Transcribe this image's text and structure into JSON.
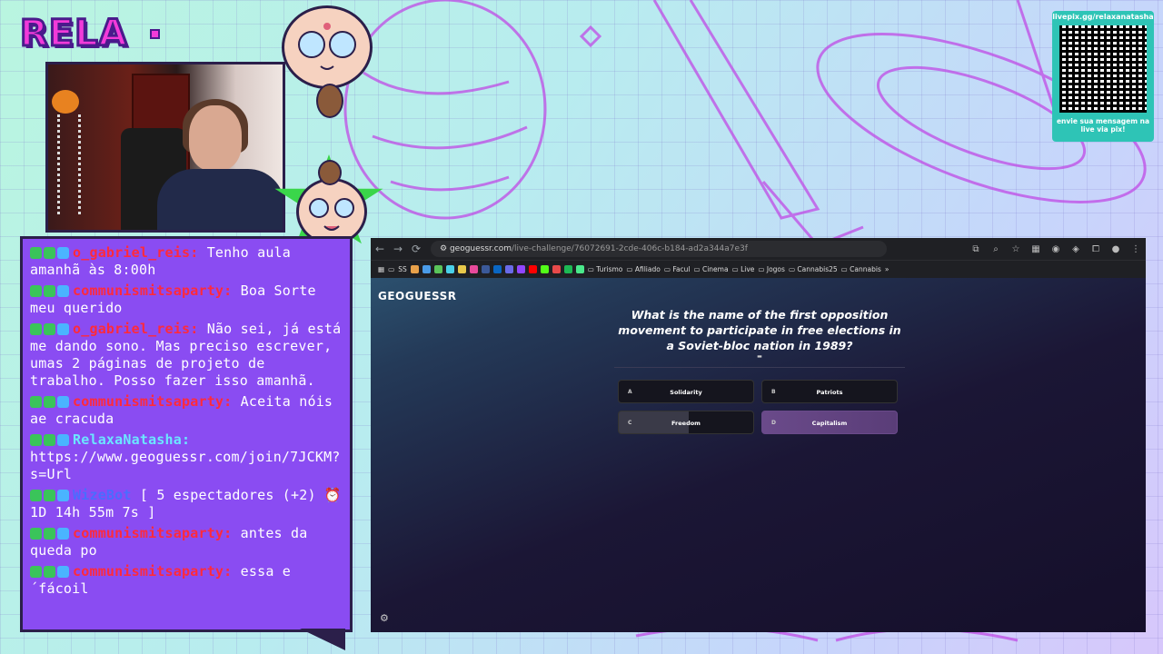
{
  "overlay": {
    "logo_text": "RELA",
    "qr_url": "livepix.gg/relaxanatasha",
    "qr_caption": "envie sua mensagem na live via pix!"
  },
  "chat": {
    "messages": [
      {
        "user": "o_gabriel_reis:",
        "user_color": "red",
        "text": "Tenho aula amanhã às 8:00h"
      },
      {
        "user": "communismitsaparty:",
        "user_color": "red",
        "text": "Boa Sorte meu querido"
      },
      {
        "user": "o_gabriel_reis:",
        "user_color": "red",
        "text": "Não sei, já está me dando sono. Mas preciso escrever, umas 2 páginas de projeto de trabalho. Posso fazer isso amanhã."
      },
      {
        "user": "communismitsaparty:",
        "user_color": "red",
        "text": "Aceita nóis ae cracuda"
      },
      {
        "user": "RelaxaNatasha:",
        "user_color": "cyan",
        "text": "https://www.geoguessr.com/join/7JCKM?s=Url"
      },
      {
        "user": "WizeBot",
        "user_color": "blue",
        "text": "[ 5 espectadores (+2) ⏰ 1D 14h 55m 7s ]"
      },
      {
        "user": "communismitsaparty:",
        "user_color": "red",
        "text": "antes da queda po"
      },
      {
        "user": "communismitsaparty:",
        "user_color": "red",
        "text": "essa e ´fácoil"
      }
    ]
  },
  "browser": {
    "url_host": "geoguessr.com",
    "url_path": "/live-challenge/76072691-2cde-406c-b184-ad2a344a7e3f",
    "bookmarks": [
      "SS",
      "Turismo",
      "Afiliado",
      "Facul",
      "Cinema",
      "Live",
      "Jogos",
      "Cannabis25",
      "Cannabis"
    ],
    "more": "»"
  },
  "game": {
    "logo": "GEOGUESSR",
    "question": "What is the name of the first opposition movement to participate in free elections in a Soviet-bloc nation in 1989?",
    "answers": [
      {
        "letter": "A",
        "label": "Solidarity"
      },
      {
        "letter": "B",
        "label": "Patriots"
      },
      {
        "letter": "C",
        "label": "Freedom"
      },
      {
        "letter": "D",
        "label": "Capitalism"
      }
    ]
  }
}
